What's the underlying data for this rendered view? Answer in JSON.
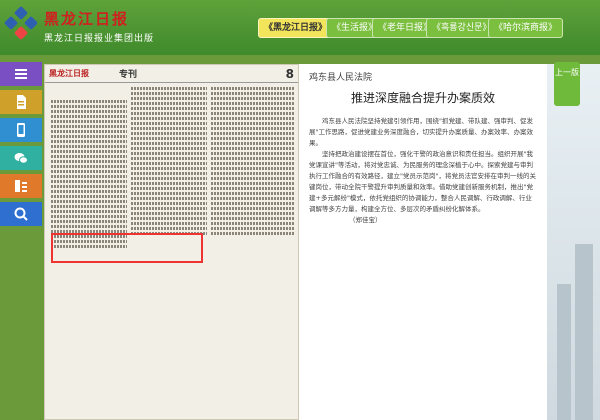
{
  "header": {
    "logo_title": "黑龙江日报",
    "logo_subtitle": "黑龙江日报报业集团出版",
    "tabs": [
      {
        "label": "《黑龙江日报》",
        "active": true
      },
      {
        "label": "《生活报》",
        "active": false
      },
      {
        "label": "《老年日报》",
        "active": false
      },
      {
        "label": "《흑룡강신문》",
        "active": false
      },
      {
        "label": "《哈尔滨商报》",
        "active": false
      }
    ]
  },
  "sidebar": {
    "items": [
      {
        "icon": "menu-icon"
      },
      {
        "icon": "pdf-icon"
      },
      {
        "icon": "phone-icon"
      },
      {
        "icon": "chat-icon"
      },
      {
        "icon": "share-icon"
      },
      {
        "icon": "search-icon"
      }
    ]
  },
  "paper": {
    "masthead": "黑龙江日报",
    "column_label": "专刊",
    "page_number": "8"
  },
  "version_button": "上一版",
  "article": {
    "source": "鸡东县人民法院",
    "title": "推进深度融合提升办案质效",
    "paragraphs": [
      "鸡东县人民法院坚持党建引领作用，围绕\"抓党建、带队建、强审判、促发展\"工作思路，促进党建业务深度融合，切实提升办案质量、办案效率、办案效果。",
      "坚持把政治建设摆在首位，强化干警的政治意识和责任担当。组织开展\"我党课宣讲\"等活动，将对党忠诚、为民服务的理念深植于心中。探索党建与审判执行工作融合的有效路径，建立\"党员示范岗\"，将党员法官安排在审判一线的关键岗位，带动全院干警提升审判质量和效率。借助党建创新服务机制，推出\"党建+多元解纷\"模式，依托党组织的协调能力，整合人民调解、行政调解、行业调解等多方力量，构建全方位、多层次的矛盾纠纷化解体系。"
    ],
    "signature": "（郑佳宝）"
  },
  "colors": {
    "header_green": "#4f9a33",
    "active_tab": "#f3e55b",
    "sidebar": [
      "#7a4fc4",
      "#d0a12a",
      "#2f8fd0",
      "#2fb0a0",
      "#e07a2a",
      "#2f6fd0"
    ],
    "highlight": "#ee3333"
  }
}
